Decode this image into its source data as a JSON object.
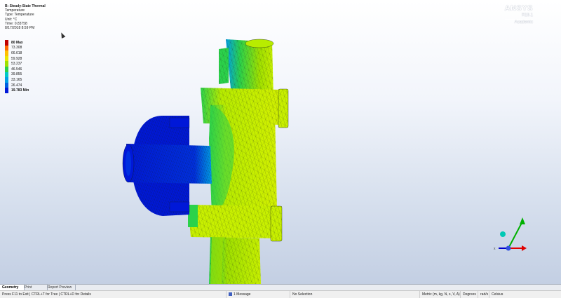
{
  "info": {
    "title": "B: Steady-State Thermal",
    "line1": "Temperature",
    "line2": "Type: Temperature",
    "line3": "Unit: °C",
    "line4": "Time: 0.83758",
    "line5": "8/17/2018 8:59 PM"
  },
  "legend": {
    "entries": [
      {
        "label": "80 Max",
        "color": "#c00000"
      },
      {
        "label": "73.308",
        "color": "#ff6a00"
      },
      {
        "label": "66.618",
        "color": "#ffc000"
      },
      {
        "label": "59.928",
        "color": "#e8e800"
      },
      {
        "label": "53.237",
        "color": "#9fe000"
      },
      {
        "label": "46.546",
        "color": "#2bd24a"
      },
      {
        "label": "39.855",
        "color": "#00c8c8"
      },
      {
        "label": "33.165",
        "color": "#00a0e6"
      },
      {
        "label": "26.474",
        "color": "#0060e0"
      },
      {
        "label": "19.783 Min",
        "color": "#0018d8"
      }
    ]
  },
  "brand": {
    "logo": "ANSYS",
    "version": "R19.1",
    "edition": "Academic"
  },
  "tabs": [
    "Geometry",
    "Print Preview",
    "Report Preview"
  ],
  "status": {
    "hint": "Press F11 to Exit | CTRL+T for Tree | CTRL+D for Details",
    "messages": "1 Message",
    "selection": "No Selection",
    "units": "Metric (m, kg, N, s, V, A)",
    "angle": "Degrees",
    "rate": "rad/s",
    "temp": "Celsius"
  },
  "colors": {
    "cold": "#0018d8",
    "mid": "#2bd24a",
    "warm": "#c8f000",
    "axis_y": "#00b000",
    "axis_x": "#e00000",
    "axis_z": "#0000cc"
  }
}
